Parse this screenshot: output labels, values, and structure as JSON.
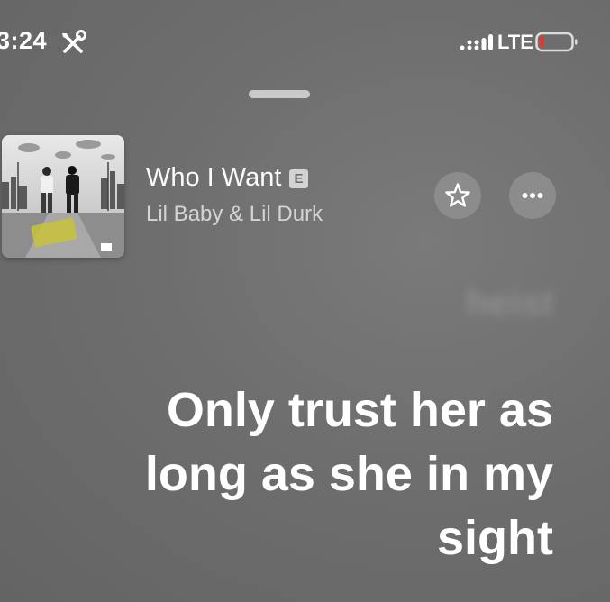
{
  "status_bar": {
    "time": "3:24",
    "network": "LTE",
    "icons": [
      "tools-icon",
      "signal-icon",
      "battery-icon"
    ],
    "battery_color": "#e8342f"
  },
  "now_playing": {
    "title": "Who I Want",
    "explicit_badge": "E",
    "artist": "Lil Baby & Lil Durk",
    "actions": [
      "star-icon",
      "more-icon"
    ]
  },
  "lyrics": {
    "previous_line": "heist",
    "current_lines": [
      "Only trust her as",
      "long as she in my",
      "sight"
    ]
  }
}
